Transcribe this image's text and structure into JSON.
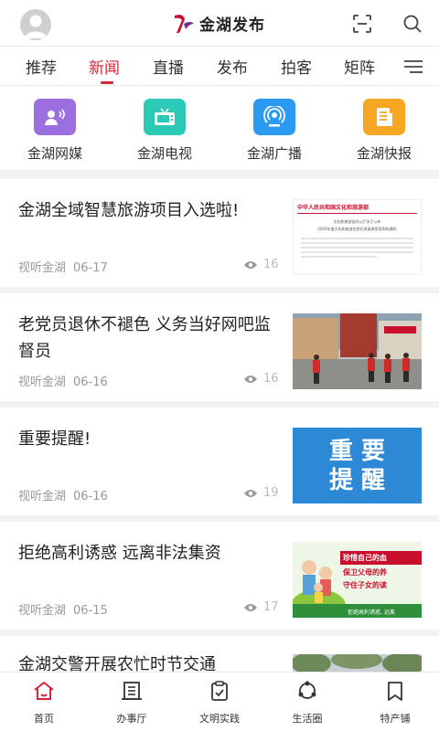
{
  "header": {
    "logo_text": "金湖发布",
    "avatar_icon": "user-avatar-icon",
    "scan_icon": "scan-icon",
    "search_icon": "search-icon"
  },
  "tabs": [
    {
      "label": "推荐"
    },
    {
      "label": "新闻",
      "active": true
    },
    {
      "label": "直播"
    },
    {
      "label": "发布"
    },
    {
      "label": "拍客"
    },
    {
      "label": "矩阵"
    }
  ],
  "channels": [
    {
      "label": "金湖网媒",
      "color": "#9b6fe0",
      "icon": "megaphone-icon"
    },
    {
      "label": "金湖电视",
      "color": "#2cc9b6",
      "icon": "tv-icon"
    },
    {
      "label": "金湖广播",
      "color": "#2a9bf0",
      "icon": "broadcast-icon"
    },
    {
      "label": "金湖快报",
      "color": "#f5a623",
      "icon": "newspaper-icon"
    }
  ],
  "news": [
    {
      "title": "金湖全域智慧旅游项目入选啦!",
      "source": "视听金湖",
      "date": "06-17",
      "views": "16",
      "thumb": "document"
    },
    {
      "title": "老党员退休不褪色 义务当好网吧监督员",
      "source": "视听金湖",
      "date": "06-16",
      "views": "16",
      "thumb": "street"
    },
    {
      "title": "重要提醒!",
      "source": "视听金湖",
      "date": "06-16",
      "views": "19",
      "thumb": "notice",
      "thumb_text_1": "重 要",
      "thumb_text_2": "提 醒"
    },
    {
      "title": "拒绝高利诱惑 远离非法集资",
      "source": "视听金湖",
      "date": "06-15",
      "views": "17",
      "thumb": "poster",
      "thumb_text_1": "珍惜自己的血",
      "thumb_text_2": "保卫父母的养",
      "thumb_text_3": "守住子女的读",
      "thumb_text_4": "拒绝高利诱惑, 远离"
    },
    {
      "title": "金湖交警开展农忙时节交通",
      "thumb": "road"
    }
  ],
  "thumb_doc": {
    "heading": "中华人民共和国文化和旅游部",
    "line1": "文化和旅游部办公厅关于公布",
    "line2": "2020年度文化和旅游信息化发展典型案例的通知"
  },
  "bottom_nav": [
    {
      "label": "首页",
      "icon": "home-icon",
      "active": true
    },
    {
      "label": "办事厅",
      "icon": "service-hall-icon"
    },
    {
      "label": "文明实践",
      "icon": "clipboard-icon"
    },
    {
      "label": "生活圈",
      "icon": "life-circle-icon"
    },
    {
      "label": "特产铺",
      "icon": "bookmark-shop-icon"
    }
  ],
  "colors": {
    "accent": "#d6263a",
    "logo_red": "#c8102e",
    "logo_purple": "#7a2c8e"
  }
}
